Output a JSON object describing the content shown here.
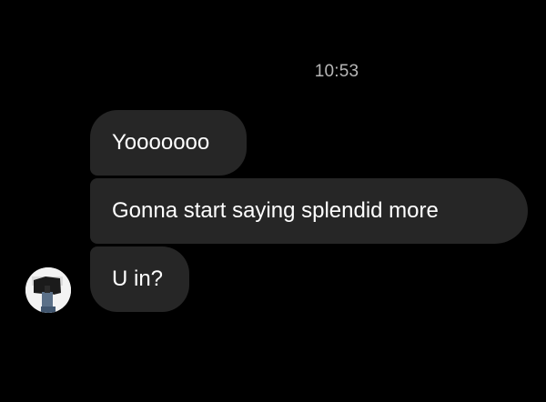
{
  "thread": {
    "timestamp": "10:53",
    "messages": [
      {
        "text": "Yooooooo"
      },
      {
        "text": "Gonna start saying splendid more"
      },
      {
        "text": "U in?"
      }
    ]
  },
  "colors": {
    "background": "#000000",
    "bubble": "#262626",
    "text": "#ffffff",
    "timestamp": "#b7b7b7"
  },
  "icons": {
    "avatar": "contact-photo"
  }
}
